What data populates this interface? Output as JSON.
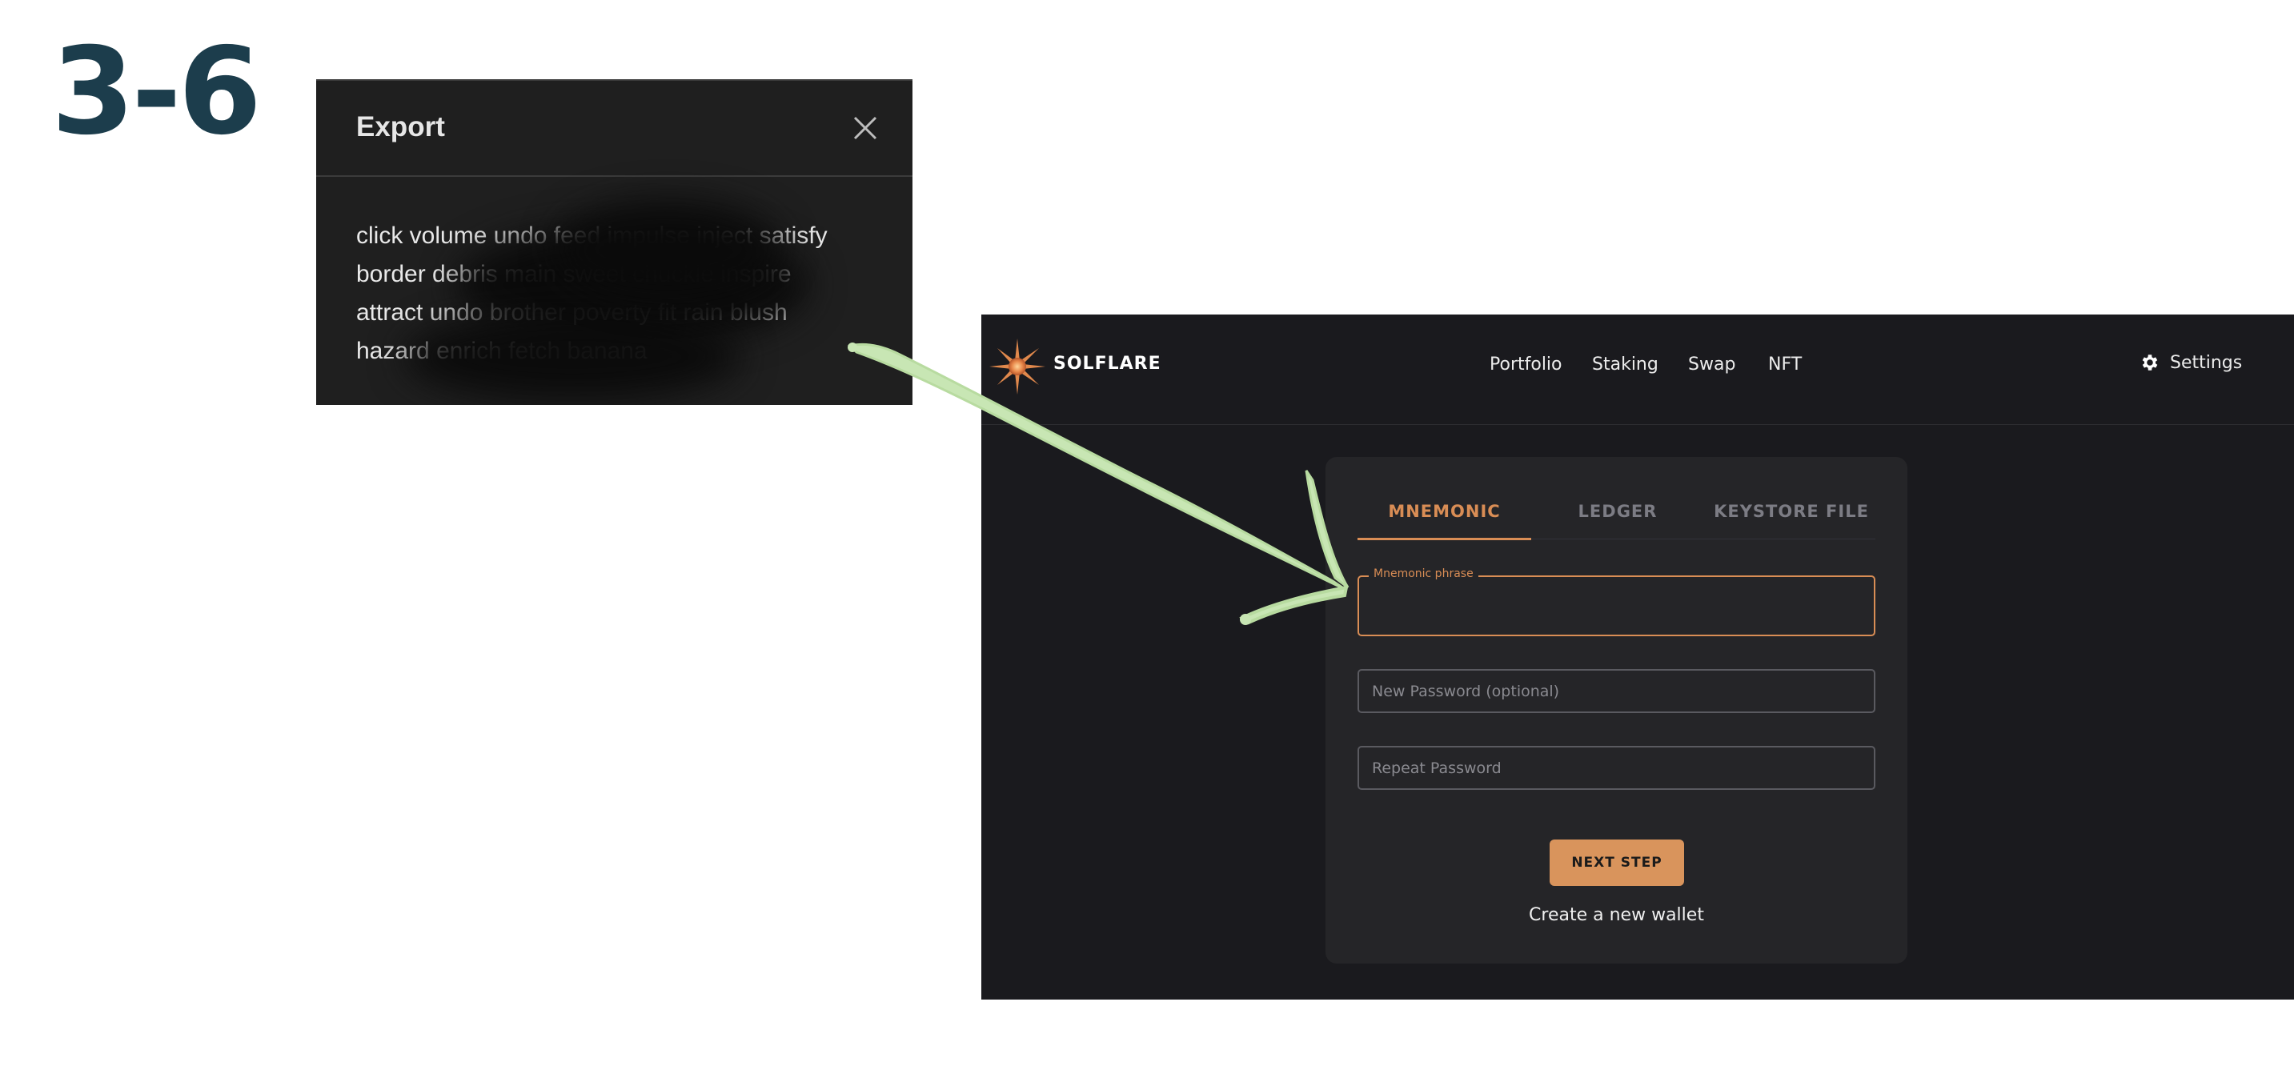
{
  "step_label": "3-6",
  "export_modal": {
    "title": "Export",
    "close_icon": "close-icon",
    "mnemonic_lines": [
      "click volume undo feed impulse inject satisfy",
      "border debris main sweet chuckle inspire",
      "attract undo brother poverty fit rain blush",
      "hazard enrich fetch banana"
    ]
  },
  "app": {
    "brand": "SOLFLARE",
    "logo_icon": "solflare-sun-logo",
    "nav": {
      "portfolio": "Portfolio",
      "staking": "Staking",
      "swap": "Swap",
      "nft": "NFT"
    },
    "settings": {
      "label": "Settings",
      "icon": "gear-icon"
    },
    "tabs": [
      "MNEMONIC",
      "LEDGER",
      "KEYSTORE FILE"
    ],
    "active_tab": "MNEMONIC",
    "form": {
      "mnemonic_label": "Mnemonic phrase",
      "mnemonic_value": "",
      "new_password_placeholder": "New Password (optional)",
      "repeat_password_placeholder": "Repeat Password",
      "next_button": "NEXT STEP",
      "create_link": "Create a new wallet"
    },
    "colors": {
      "accent": "#d98d55",
      "background": "#1a1a1e",
      "card": "#252528",
      "arrow": "#c8e6b4"
    }
  }
}
